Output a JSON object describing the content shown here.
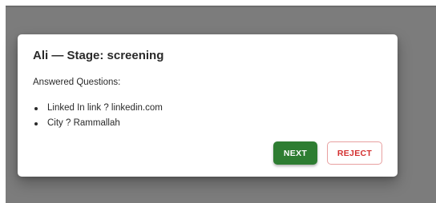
{
  "dialog": {
    "title": "Ali — Stage: screening",
    "subtitle": "Answered Questions:",
    "answers": [
      {
        "text": "Linked In link ? linkedin.com"
      },
      {
        "text": "City ? Rammallah"
      }
    ],
    "next_label": "NEXT",
    "reject_label": "REJECT"
  },
  "colors": {
    "next_button": "#2e7d32",
    "reject_text": "#d32f2f",
    "backdrop": "#7c7c7c"
  }
}
